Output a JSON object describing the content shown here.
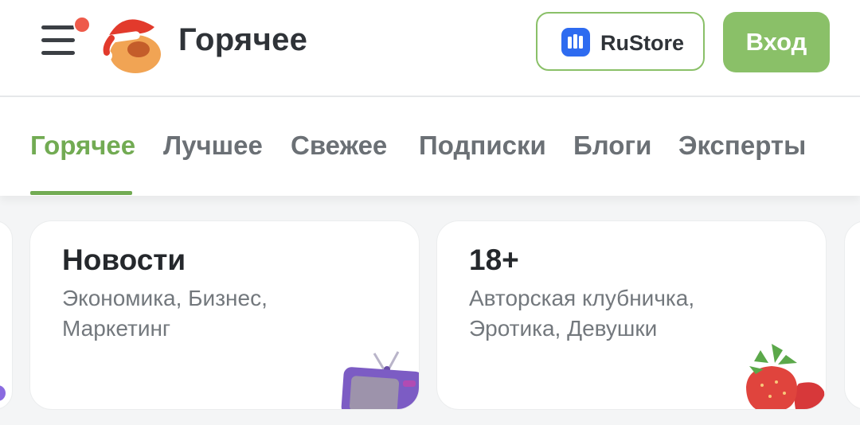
{
  "header": {
    "menu_icon": "hamburger-menu-icon",
    "logo": "pikabu-logo",
    "title": "Горячее",
    "rustore_label": "RuStore",
    "login_label": "Вход",
    "colors": {
      "accent": "#8ac068",
      "notification": "#ee5a4a",
      "rustore_blue": "#2e6bf0"
    }
  },
  "tabs": [
    {
      "label": "Горячее",
      "active": true
    },
    {
      "label": "Лучшее",
      "active": false
    },
    {
      "label": "Свежее",
      "active": false
    },
    {
      "label": "Подписки",
      "active": false
    },
    {
      "label": "Блоги",
      "active": false
    },
    {
      "label": "Эксперты",
      "active": false
    }
  ],
  "cards": [
    {
      "title": "Новости",
      "description": "Экономика, Бизнес, Маркетинг",
      "icon": "tv-icon"
    },
    {
      "title": "18+",
      "description": "Авторская клубничка, Эротика, Девушки",
      "icon": "strawberry-icon"
    }
  ]
}
